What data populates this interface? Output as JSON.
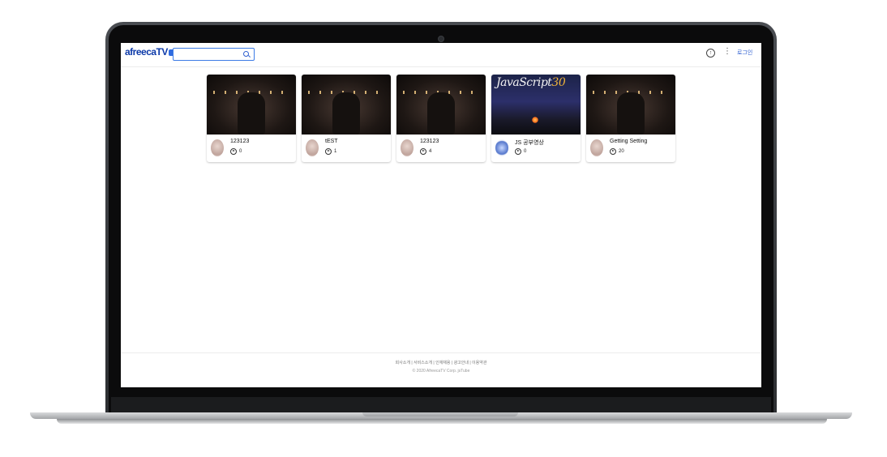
{
  "header": {
    "logo_text": "afreecaTV",
    "search": {
      "value": "",
      "placeholder": ""
    },
    "login_label": "로그인"
  },
  "videos": [
    {
      "title": "123123",
      "views": "0",
      "thumbnail": "dark-room"
    },
    {
      "title": "tEST",
      "views": "1",
      "thumbnail": "dark-room"
    },
    {
      "title": "123123",
      "views": "4",
      "thumbnail": "dark-room"
    },
    {
      "title": "JS 공부영상",
      "views": "0",
      "thumbnail": "javascript30",
      "thumb_text": "JavaScript",
      "thumb_number": "30"
    },
    {
      "title": "Getting Setting",
      "views": "20",
      "thumbnail": "dark-room"
    }
  ],
  "footer": {
    "links": "회사소개 | 서비스소개 | 인재채용 | 광고안내 | 이용약관",
    "copyright": "© 2020 AfreecaTV Corp. jsTube"
  },
  "colors": {
    "brand": "#0d3aa9",
    "accent": "#3c7be6",
    "link": "#2f5fd0"
  },
  "icons": {
    "search": "search-icon",
    "upload": "upload-icon",
    "more": "more-vertical-icon",
    "play": "play-circle-icon"
  }
}
